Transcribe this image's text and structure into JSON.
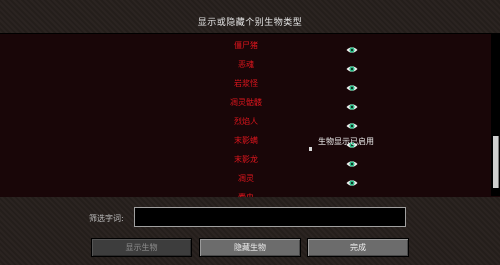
{
  "screen": {
    "title": "显示或隐藏个别生物类型"
  },
  "mob_list": {
    "items": [
      {
        "label": "僵尸猪",
        "visible": true
      },
      {
        "label": "恶魂",
        "visible": true
      },
      {
        "label": "岩浆怪",
        "visible": true
      },
      {
        "label": "凋灵骷髅",
        "visible": true
      },
      {
        "label": "烈焰人",
        "visible": true
      },
      {
        "label": "末影螨",
        "visible": true
      },
      {
        "label": "末影龙",
        "visible": true
      },
      {
        "label": "凋灵",
        "visible": true
      },
      {
        "label": "蠹虫",
        "visible": true
      }
    ],
    "eye_icon": "eye-icon",
    "scroll_position": 0.6
  },
  "tooltip": {
    "text": "生物显示已启用"
  },
  "filter": {
    "label": "筛选字词:",
    "value": "",
    "placeholder": ""
  },
  "buttons": {
    "show_all": "显示生物",
    "hide_all": "隐藏生物",
    "done": "完成"
  },
  "colors": {
    "mob_label": "#e0151d",
    "list_background": "#190608",
    "eye_green": "#2fbf8a"
  }
}
